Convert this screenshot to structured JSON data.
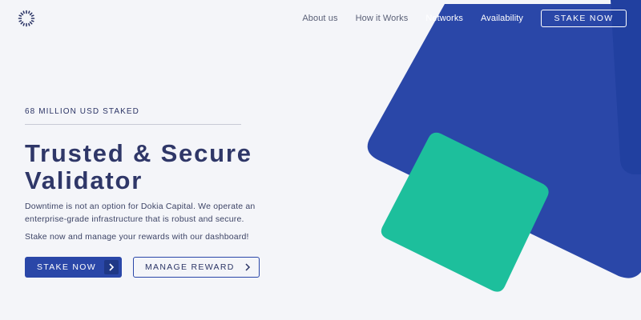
{
  "header": {
    "logo_icon": "sunburst-logo-icon",
    "nav": {
      "about": "About us",
      "how": "How it Works",
      "networks": "Networks",
      "availability": "Availability"
    },
    "cta_label": "STAKE NOW"
  },
  "hero": {
    "eyebrow": "68 MILLION USD STAKED",
    "title_line1": "Trusted & Secure",
    "title_line2": "Validator",
    "description": "Downtime is not an option for Dokia Capital. We operate an enterprise-grade infrastructure that is robust and secure.",
    "subtext": "Stake now and manage your rewards with our dashboard!",
    "primary_button": "STAKE NOW",
    "primary_icon": "chevron-right-icon",
    "secondary_button": "MANAGE REWARD",
    "secondary_icon": "chevron-right-icon"
  },
  "colors": {
    "background": "#f4f5f9",
    "primary_blue": "#2a47a8",
    "dark_blue": "#1f3886",
    "teal": "#1dbf9c",
    "text_navy": "#2c3566"
  }
}
